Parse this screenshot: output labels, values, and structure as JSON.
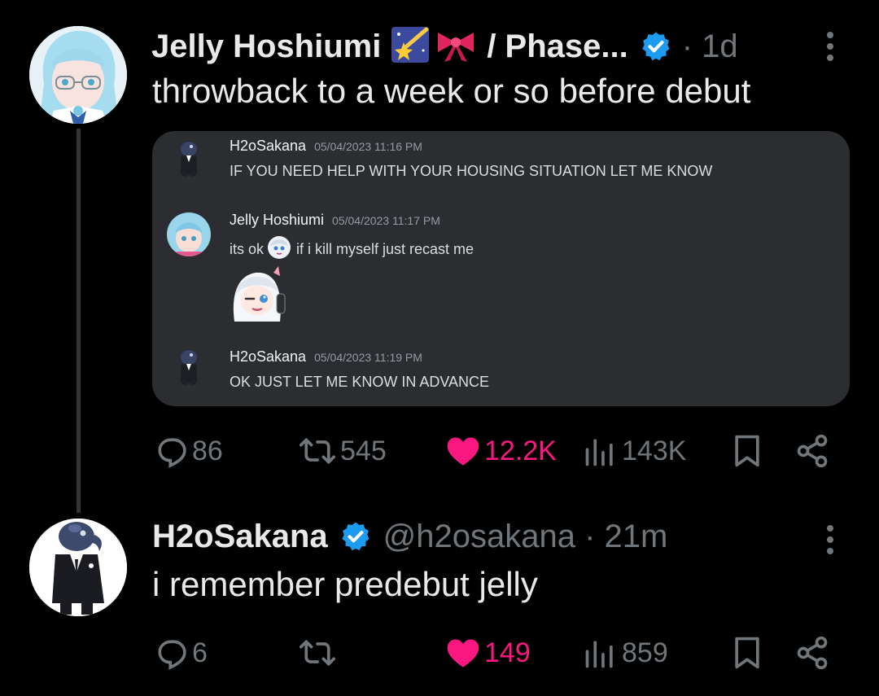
{
  "tweet1": {
    "display_name": "Jelly Hoshiumi",
    "name_emojis": [
      "shooting-star",
      "ribbon"
    ],
    "name_suffix": "/ Phase...",
    "time": "· 1d",
    "text": "throwback to a week or so before debut",
    "embed": {
      "messages": [
        {
          "author": "H2oSakana",
          "time": "05/04/2023 11:16 PM",
          "text": "IF YOU NEED HELP WITH YOUR HOUSING SITUATION LET ME KNOW"
        },
        {
          "author": "Jelly Hoshiumi",
          "time": "05/04/2023 11:17 PM",
          "text_before": "its ok",
          "text_after": "if i kill myself just recast me"
        },
        {
          "author": "H2oSakana",
          "time": "05/04/2023 11:19 PM",
          "text": "OK JUST LET ME KNOW IN ADVANCE"
        }
      ]
    },
    "stats": {
      "replies": "86",
      "reposts": "545",
      "likes": "12.2K",
      "views": "143K"
    }
  },
  "tweet2": {
    "display_name": "H2oSakana",
    "handle_time": "@h2osakana · 21m",
    "text": "i remember predebut jelly",
    "stats": {
      "replies": "6",
      "reposts": "",
      "likes": "149",
      "views": "859"
    }
  },
  "colors": {
    "background": "#000000",
    "text": "#e7e9ea",
    "muted": "#71767b",
    "like": "#f91880",
    "verified": "#1d9bf0",
    "embed_bg": "#2b2d31"
  }
}
